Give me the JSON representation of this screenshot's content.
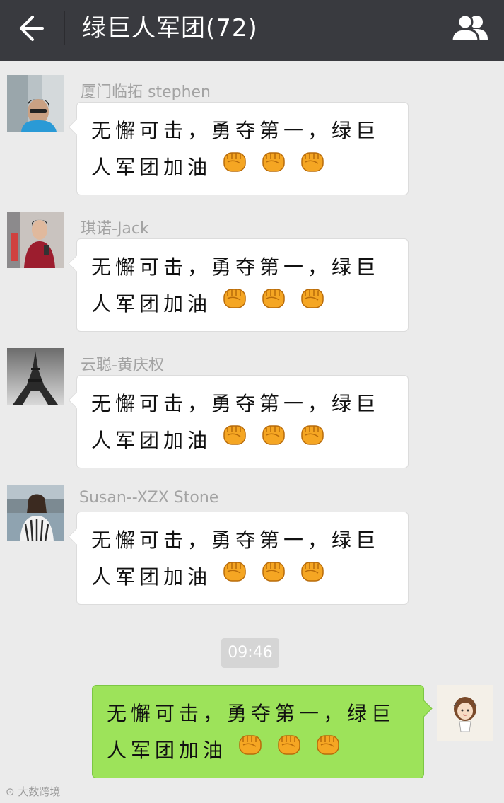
{
  "header": {
    "title": "绿巨人军团(72)",
    "back_icon": "arrow-left-icon",
    "members_icon": "group-members-icon",
    "background": "#393a3f"
  },
  "messages": [
    {
      "sender": "厦门临拓 stephen",
      "text": "无懈可击，勇夺第一，绿巨人军团加油",
      "emoji": "fist-emoji ×3"
    },
    {
      "sender": "琪诺-Jack",
      "text": "无懈可击，勇夺第一，绿巨人军团加油",
      "emoji": "fist-emoji ×3"
    },
    {
      "sender": "云聪-黄庆权",
      "text": "无懈可击，勇夺第一，绿巨人军团加油",
      "emoji": "fist-emoji ×3"
    },
    {
      "sender": "Susan--XZX Stone",
      "text": "无懈可击，勇夺第一，绿巨人军团加油",
      "emoji": "fist-emoji ×3"
    }
  ],
  "timestamp": "09:46",
  "my_message": {
    "text": "无懈可击，勇夺第一，绿巨人军团加油",
    "bubble_color": "#9de35a"
  },
  "watermark": "大数跨境",
  "colors": {
    "chat_background": "#ebebeb",
    "sender_name": "#a3a3a3"
  }
}
